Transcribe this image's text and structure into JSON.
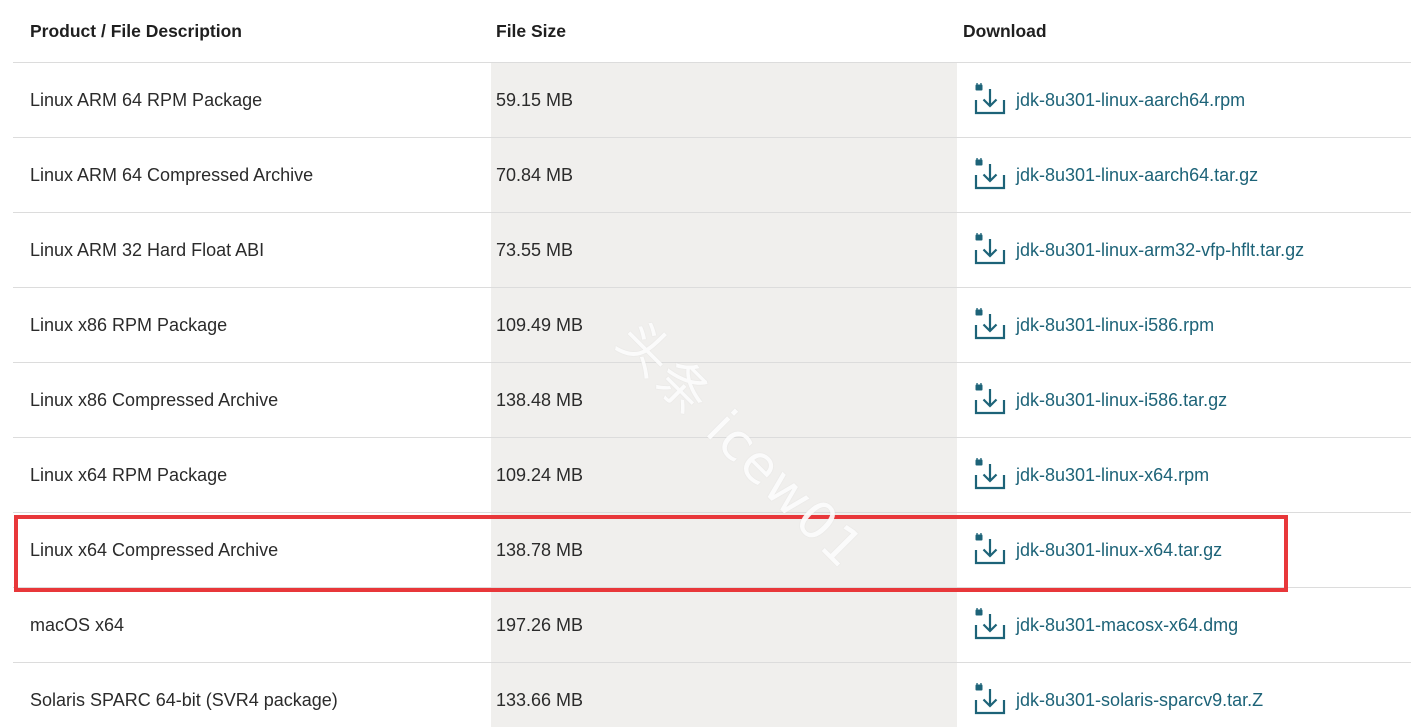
{
  "columns": {
    "product": "Product / File Description",
    "size": "File Size",
    "download": "Download"
  },
  "rows": [
    {
      "product": "Linux ARM 64 RPM Package",
      "size": "59.15 MB",
      "file": "jdk-8u301-linux-aarch64.rpm"
    },
    {
      "product": "Linux ARM 64 Compressed Archive",
      "size": "70.84 MB",
      "file": "jdk-8u301-linux-aarch64.tar.gz"
    },
    {
      "product": "Linux ARM 32 Hard Float ABI",
      "size": "73.55 MB",
      "file": "jdk-8u301-linux-arm32-vfp-hflt.tar.gz"
    },
    {
      "product": "Linux x86 RPM Package",
      "size": "109.49 MB",
      "file": "jdk-8u301-linux-i586.rpm"
    },
    {
      "product": "Linux x86 Compressed Archive",
      "size": "138.48 MB",
      "file": "jdk-8u301-linux-i586.tar.gz"
    },
    {
      "product": "Linux x64 RPM Package",
      "size": "109.24 MB",
      "file": "jdk-8u301-linux-x64.rpm"
    },
    {
      "product": "Linux x64 Compressed Archive",
      "size": "138.78 MB",
      "file": "jdk-8u301-linux-x64.tar.gz"
    },
    {
      "product": "macOS x64",
      "size": "197.26 MB",
      "file": "jdk-8u301-macosx-x64.dmg"
    },
    {
      "product": "Solaris SPARC 64-bit (SVR4 package)",
      "size": "133.66 MB",
      "file": "jdk-8u301-solaris-sparcv9.tar.Z"
    }
  ],
  "highlighted_row": 6,
  "watermark": "头条 icew01",
  "colors": {
    "link": "#1d6378",
    "highlight": "#e8373a",
    "size_column_bg": "#f0efed"
  },
  "icons": {
    "download": "download-lock-icon"
  }
}
